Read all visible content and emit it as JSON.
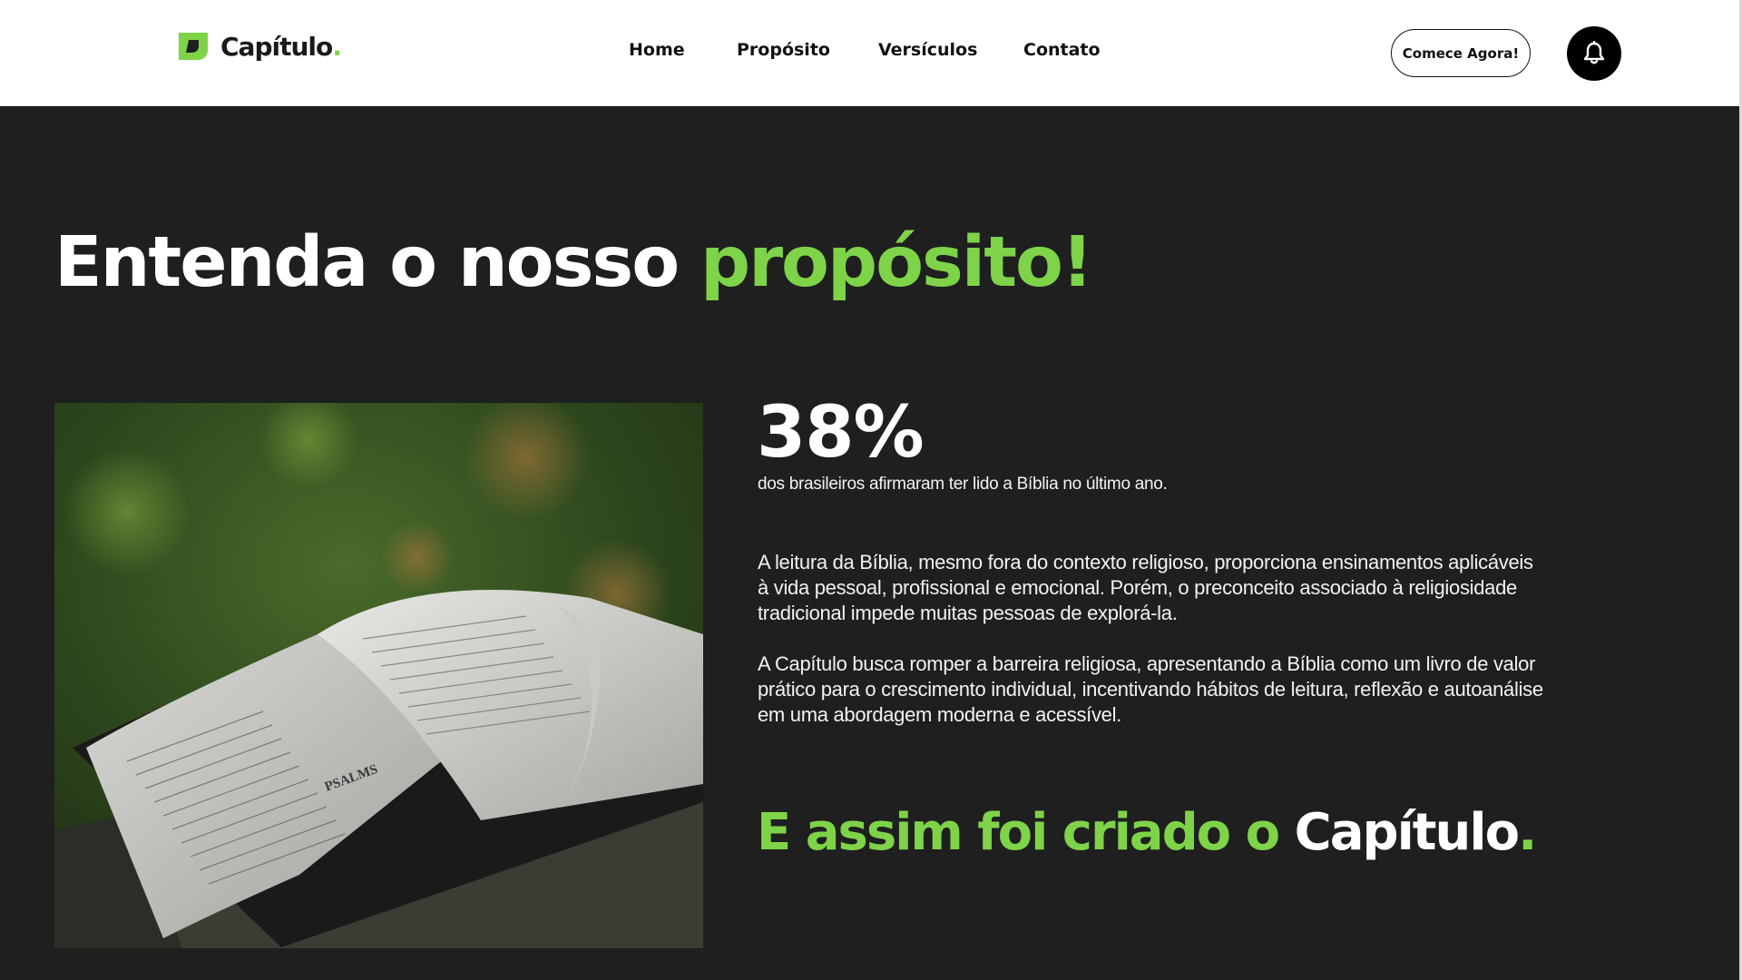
{
  "header": {
    "logo_text": "Capítulo",
    "logo_dot": ".",
    "nav": [
      {
        "label": "Home"
      },
      {
        "label": "Propósito"
      },
      {
        "label": "Versículos"
      },
      {
        "label": "Contato"
      }
    ],
    "cta_label": "Comece Agora!",
    "bell_icon": "bell-icon"
  },
  "hero": {
    "title_main": "Entenda o nosso ",
    "title_accent": "propósito!"
  },
  "stat": {
    "value": "38%",
    "caption": "dos brasileiros afirmaram ter lido a Bíblia no último ano."
  },
  "paragraphs": [
    "A leitura da Bíblia, mesmo fora do contexto religioso, proporciona ensinamentos aplicáveis à vida pessoal, profissional e emocional. Porém, o preconceito associado à religiosidade tradicional impede muitas pessoas de explorá-la.",
    "A Capítulo busca romper a barreira religiosa, apresentando a Bíblia como um livro de valor prático para o crescimento individual, incentivando hábitos de leitura, reflexão e autoanálise em uma abordagem moderna e acessível."
  ],
  "closing": {
    "prefix": "E assim foi criado o ",
    "brand": "Capítulo",
    "dot": "."
  },
  "photo": {
    "book_text": "PSALMS"
  },
  "colors": {
    "accent": "#7ed348",
    "background": "#1f1f1f",
    "header_bg": "#ffffff"
  }
}
